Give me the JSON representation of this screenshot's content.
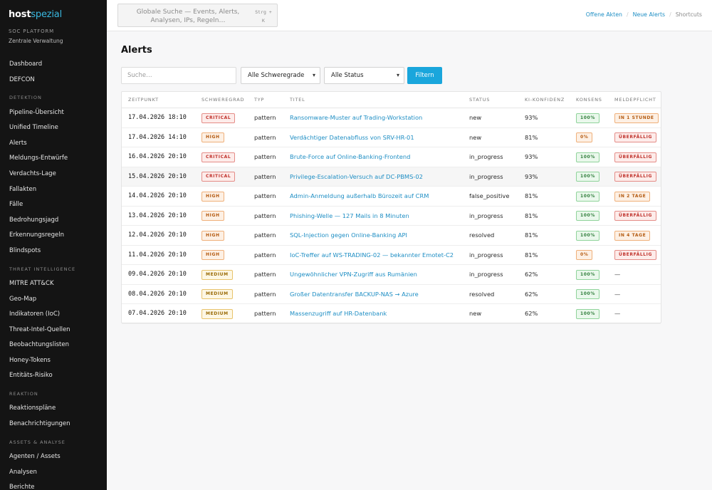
{
  "sidebar": {
    "brand": {
      "part1": "host",
      "part2": "spezial"
    },
    "platform": "SOC PLATFORM",
    "admin": "Zentrale Verwaltung",
    "top_items": [
      {
        "label": "Dashboard",
        "name": "sidebar-item-dashboard"
      },
      {
        "label": "DEFCON",
        "name": "sidebar-item-defcon"
      }
    ],
    "sections": [
      {
        "title": "DETEKTION",
        "items": [
          {
            "label": "Pipeline-Übersicht",
            "name": "sidebar-item-pipeline-uebersicht"
          },
          {
            "label": "Unified Timeline",
            "name": "sidebar-item-unified-timeline"
          },
          {
            "label": "Alerts",
            "name": "sidebar-item-alerts"
          },
          {
            "label": "Meldungs-Entwürfe",
            "name": "sidebar-item-meldungs-entwuerfe"
          },
          {
            "label": "Verdachts-Lage",
            "name": "sidebar-item-verdachts-lage"
          },
          {
            "label": "Fallakten",
            "name": "sidebar-item-fallakten"
          },
          {
            "label": "Fälle",
            "name": "sidebar-item-faelle"
          },
          {
            "label": "Bedrohungsjagd",
            "name": "sidebar-item-bedrohungsjagd"
          },
          {
            "label": "Erkennungsregeln",
            "name": "sidebar-item-erkennungsregeln"
          },
          {
            "label": "Blindspots",
            "name": "sidebar-item-blindspots"
          }
        ]
      },
      {
        "title": "THREAT INTELLIGENCE",
        "items": [
          {
            "label": "MITRE ATT&CK",
            "name": "sidebar-item-mitre-attack"
          },
          {
            "label": "Geo-Map",
            "name": "sidebar-item-geo-map"
          },
          {
            "label": "Indikatoren (IoC)",
            "name": "sidebar-item-indikatoren"
          },
          {
            "label": "Threat-Intel-Quellen",
            "name": "sidebar-item-threat-intel-quellen"
          },
          {
            "label": "Beobachtungslisten",
            "name": "sidebar-item-beobachtungslisten"
          },
          {
            "label": "Honey-Tokens",
            "name": "sidebar-item-honey-tokens"
          },
          {
            "label": "Entitäts-Risiko",
            "name": "sidebar-item-entitaets-risiko"
          }
        ]
      },
      {
        "title": "REAKTION",
        "items": [
          {
            "label": "Reaktionspläne",
            "name": "sidebar-item-reaktionsplaene"
          },
          {
            "label": "Benachrichtigungen",
            "name": "sidebar-item-benachrichtigungen"
          }
        ]
      },
      {
        "title": "ASSETS & ANALYSE",
        "items": [
          {
            "label": "Agenten / Assets",
            "name": "sidebar-item-agenten-assets"
          },
          {
            "label": "Analysen",
            "name": "sidebar-item-analysen"
          },
          {
            "label": "Berichte",
            "name": "sidebar-item-berichte"
          }
        ]
      }
    ]
  },
  "topbar": {
    "search_text": "Globale Suche — Events, Alerts, Analysen, IPs, Regeln…",
    "shortcut": "Strg + K",
    "links": {
      "offene_akten": "Offene Akten",
      "neue_alerts": "Neue Alerts",
      "shortcuts": "Shortcuts"
    }
  },
  "main": {
    "title": "Alerts",
    "search_placeholder": "Suche…",
    "severity_select": "Alle Schweregrade",
    "status_select": "Alle Status",
    "filter_button": "Filtern"
  },
  "table": {
    "columns": [
      "ZEITPUNKT",
      "SCHWEREGRAD",
      "TYP",
      "TITEL",
      "STATUS",
      "KI-KONFIDENZ",
      "KONSENS",
      "MELDEPFLICHT"
    ],
    "rows": [
      {
        "time": "17.04.2026 18:10",
        "severity": "CRITICAL",
        "sev_class": "sev-critical",
        "type": "pattern",
        "title": "Ransomware-Muster auf Trading-Workstation",
        "status": "new",
        "confidence": "93%",
        "consensus": "100%",
        "con_class": "con-green",
        "reporting": "IN 1 STUNDE",
        "rep_class": "mel-orange"
      },
      {
        "time": "17.04.2026 14:10",
        "severity": "HIGH",
        "sev_class": "sev-high",
        "type": "pattern",
        "title": "Verdächtiger Datenabfluss von SRV-HR-01",
        "status": "new",
        "confidence": "81%",
        "consensus": "0%",
        "con_class": "con-orange",
        "reporting": "ÜBERFÄLLIG",
        "rep_class": "mel-red"
      },
      {
        "time": "16.04.2026 20:10",
        "severity": "CRITICAL",
        "sev_class": "sev-critical",
        "type": "pattern",
        "title": "Brute-Force auf Online-Banking-Frontend",
        "status": "in_progress",
        "confidence": "93%",
        "consensus": "100%",
        "con_class": "con-green",
        "reporting": "ÜBERFÄLLIG",
        "rep_class": "mel-red"
      },
      {
        "time": "15.04.2026 20:10",
        "severity": "CRITICAL",
        "sev_class": "sev-critical",
        "type": "pattern",
        "title": "Privilege-Escalation-Versuch auf DC-PBMS-02",
        "status": "in_progress",
        "confidence": "93%",
        "consensus": "100%",
        "con_class": "con-green",
        "reporting": "ÜBERFÄLLIG",
        "rep_class": "mel-red"
      },
      {
        "time": "14.04.2026 20:10",
        "severity": "HIGH",
        "sev_class": "sev-high",
        "type": "pattern",
        "title": "Admin-Anmeldung außerhalb Bürozeit auf CRM",
        "status": "false_positive",
        "confidence": "81%",
        "consensus": "100%",
        "con_class": "con-green",
        "reporting": "IN 2 TAGE",
        "rep_class": "mel-orange"
      },
      {
        "time": "13.04.2026 20:10",
        "severity": "HIGH",
        "sev_class": "sev-high",
        "type": "pattern",
        "title": "Phishing-Welle — 127 Mails in 8 Minuten",
        "status": "in_progress",
        "confidence": "81%",
        "consensus": "100%",
        "con_class": "con-green",
        "reporting": "ÜBERFÄLLIG",
        "rep_class": "mel-red"
      },
      {
        "time": "12.04.2026 20:10",
        "severity": "HIGH",
        "sev_class": "sev-high",
        "type": "pattern",
        "title": "SQL-Injection gegen Online-Banking API",
        "status": "resolved",
        "confidence": "81%",
        "consensus": "100%",
        "con_class": "con-green",
        "reporting": "IN 4 TAGE",
        "rep_class": "mel-orange"
      },
      {
        "time": "11.04.2026 20:10",
        "severity": "HIGH",
        "sev_class": "sev-high",
        "type": "pattern",
        "title": "IoC-Treffer auf WS-TRADING-02 — bekannter Emotet-C2",
        "status": "in_progress",
        "confidence": "81%",
        "consensus": "0%",
        "con_class": "con-orange",
        "reporting": "ÜBERFÄLLIG",
        "rep_class": "mel-red"
      },
      {
        "time": "09.04.2026 20:10",
        "severity": "MEDIUM",
        "sev_class": "sev-medium",
        "type": "pattern",
        "title": "Ungewöhnlicher VPN-Zugriff aus Rumänien",
        "status": "in_progress",
        "confidence": "62%",
        "consensus": "100%",
        "con_class": "con-green",
        "reporting": "—",
        "rep_class": ""
      },
      {
        "time": "08.04.2026 20:10",
        "severity": "MEDIUM",
        "sev_class": "sev-medium",
        "type": "pattern",
        "title": "Großer Datentransfer BACKUP-NAS → Azure",
        "status": "resolved",
        "confidence": "62%",
        "consensus": "100%",
        "con_class": "con-green",
        "reporting": "—",
        "rep_class": ""
      },
      {
        "time": "07.04.2026 20:10",
        "severity": "MEDIUM",
        "sev_class": "sev-medium",
        "type": "pattern",
        "title": "Massenzugriff auf HR-Datenbank",
        "status": "new",
        "confidence": "62%",
        "consensus": "100%",
        "con_class": "con-green",
        "reporting": "—",
        "rep_class": ""
      }
    ]
  }
}
